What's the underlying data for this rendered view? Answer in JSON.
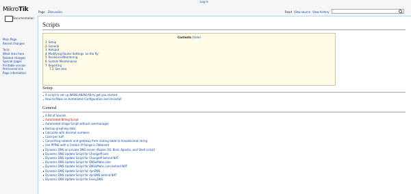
{
  "personal": {
    "login": "Log in"
  },
  "logo": {
    "brand": "MikroTik",
    "brand_a": "Mikro",
    "brand_b": "Tik",
    "label": "Documentation"
  },
  "sidebar": {
    "nav": [
      "Main Page",
      "Recent changes"
    ],
    "tools_heading": "Tools",
    "tools": [
      "What links here",
      "Related changes",
      "Special pages",
      "Printable version",
      "Permanent link",
      "Page information"
    ]
  },
  "tabs": {
    "left": [
      "Page",
      "Discussion"
    ],
    "right": [
      "Read",
      "View source",
      "View history"
    ]
  },
  "search": {
    "placeholder": "Search MikroTik Wiki"
  },
  "page": {
    "title": "Scripts"
  },
  "toc": {
    "title": "Contents",
    "toggle": "[hide]",
    "items": [
      {
        "num": "1",
        "label": "Setup"
      },
      {
        "num": "2",
        "label": "General"
      },
      {
        "num": "3",
        "label": "Hotspot"
      },
      {
        "num": "4",
        "label": "Modifying Router Settings 'on the fly'"
      },
      {
        "num": "5",
        "label": "Resilience/Monitoring"
      },
      {
        "num": "6",
        "label": "System Maintenance"
      },
      {
        "num": "7",
        "label": "Reporting"
      },
      {
        "num": "7.1",
        "label": "See also"
      }
    ]
  },
  "setup": {
    "heading": "Setup",
    "items": [
      "A script to set up WAN/LAN/WLAN to get you started",
      "How to Make an Automated Configuration and Uninstall"
    ]
  },
  "general": {
    "heading": "General",
    "items": [
      "A Bit of Sounds",
      "Automated Billing Script",
      "Automated Usage Script without usermanager",
      "Backup graphing data",
      "Calculate with decimal numbers",
      "Case pen tuff",
      "Converting network and gateway from routing table to hexadecimal string",
      "Use PPPoE with a Certain IP Range is Obtained",
      "Dynamic DNS on private DNS server (Router OS, Bind, Apache, and Shell script)",
      "Dynamic DNS Update Script for ChangeIP.com",
      "Dynamic DNS Update Script for ChangeIP behind NAT",
      "Dynamic DNS Update Script for DNSoMatic.com",
      "Dynamic DNS Update Script for DNSoMatic.com behind NAT",
      "Dynamic DNS Update Script for dynDNS",
      "Dynamic DNS Update Script for dynDNS behind NAT",
      "Dynamic DNS Update Script for EveryDNS"
    ],
    "red_index": 1
  }
}
